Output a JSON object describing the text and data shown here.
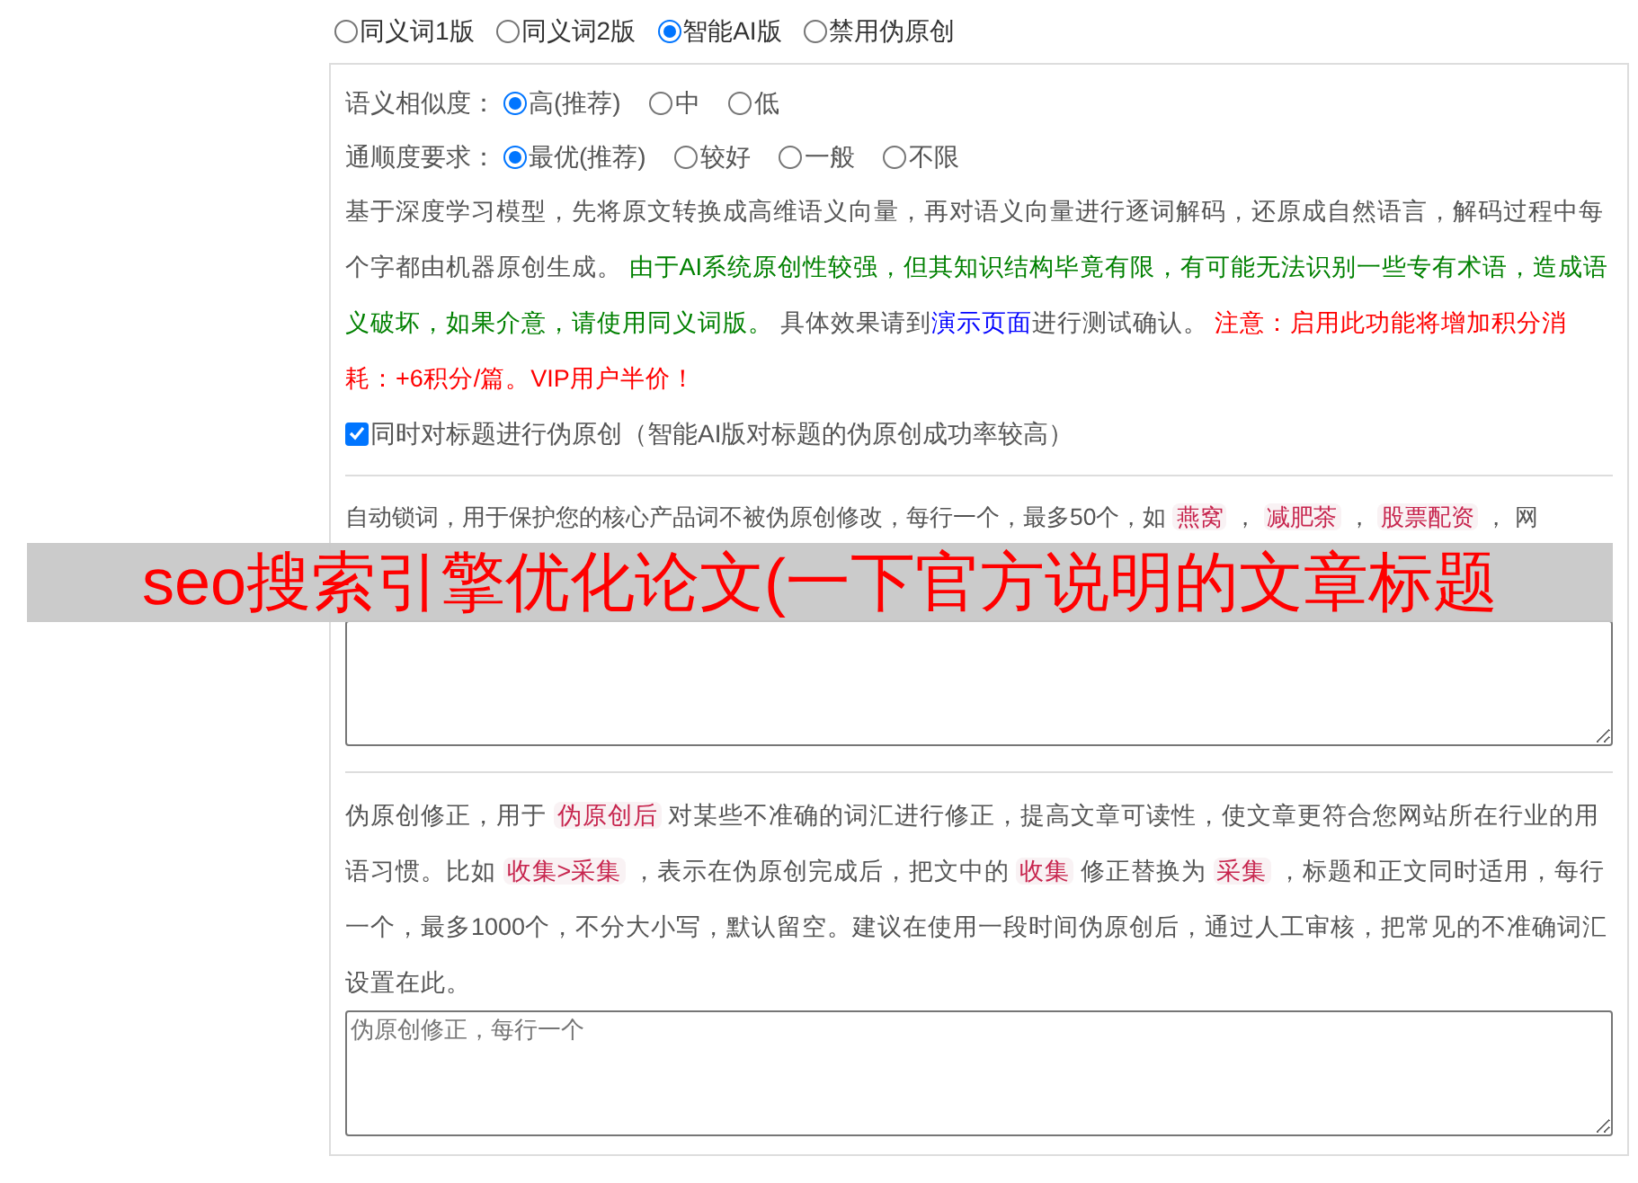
{
  "mode_options": [
    {
      "label": "同义词1版",
      "selected": false
    },
    {
      "label": "同义词2版",
      "selected": false
    },
    {
      "label": "智能AI版",
      "selected": true
    },
    {
      "label": "禁用伪原创",
      "selected": false
    }
  ],
  "ai_panel": {
    "settings": [
      {
        "label": "语义相似度：",
        "options": [
          {
            "label": "高(推荐)",
            "selected": true
          },
          {
            "label": "中",
            "selected": false
          },
          {
            "label": "低",
            "selected": false
          }
        ]
      },
      {
        "label": "通顺度要求：",
        "options": [
          {
            "label": "最优(推荐)",
            "selected": true
          },
          {
            "label": "较好",
            "selected": false
          },
          {
            "label": "一般",
            "selected": false
          },
          {
            "label": "不限",
            "selected": false
          }
        ]
      }
    ],
    "description": [
      {
        "kind": "plain",
        "text": "基于深度学习模型，先将原文转换成高维语义向量，再对语义向量进行逐词解码，还原成自然语言，解码过程中每个字都由机器原创生成。 "
      },
      {
        "kind": "green",
        "text": "由于AI系统原创性较强，但其知识结构毕竟有限，有可能无法识别一些专有术语，造成语义破坏，如果介意，请使用同义词版。"
      },
      {
        "kind": "plain",
        "text": " 具体效果请到"
      },
      {
        "kind": "link",
        "text": "演示页面"
      },
      {
        "kind": "plain",
        "text": "进行测试确认。 "
      },
      {
        "kind": "red",
        "text": "注意：启用此功能将增加积分消耗：+6积分/篇。VIP用户半价！"
      }
    ],
    "title_checkbox": {
      "label": "同时对标题进行伪原创（智能AI版对标题的伪原创成功率较高）",
      "checked": true
    }
  },
  "lock_words": {
    "description": [
      {
        "kind": "plain",
        "text": "自动锁词，用于保护您的核心产品词不被伪原创修改，每行一个，最多50个，如 "
      },
      {
        "kind": "code",
        "text": "燕窝"
      },
      {
        "kind": "plain",
        "text": " ， "
      },
      {
        "kind": "code",
        "text": "减肥茶"
      },
      {
        "kind": "plain",
        "text": " ， "
      },
      {
        "kind": "code",
        "text": "股票配资"
      },
      {
        "kind": "plain",
        "text": " ， 网"
      }
    ]
  },
  "correction": {
    "description": [
      {
        "kind": "plain",
        "text": "伪原创修正，用于 "
      },
      {
        "kind": "code",
        "text": "伪原创后"
      },
      {
        "kind": "plain",
        "text": " 对某些不准确的词汇进行修正，提高文章可读性，使文章更符合您网站所在行业的用语习惯。比如 "
      },
      {
        "kind": "code",
        "text": "收集>采集"
      },
      {
        "kind": "plain",
        "text": " ，表示在伪原创完成后，把文中的 "
      },
      {
        "kind": "code",
        "text": "收集"
      },
      {
        "kind": "plain",
        "text": " 修正替换为 "
      },
      {
        "kind": "code",
        "text": "采集"
      },
      {
        "kind": "plain",
        "text": " ，标题和正文同时适用，每行一个，最多1000个，不分大小写，默认留空。建议在使用一段时间伪原创后，通过人工审核，把常见的不准确词汇设置在此。"
      }
    ],
    "placeholder": "伪原创修正，每行一个"
  },
  "overlay_banner": {
    "text": "seo搜索引擎优化论文(一下官方说明的文章标题"
  }
}
